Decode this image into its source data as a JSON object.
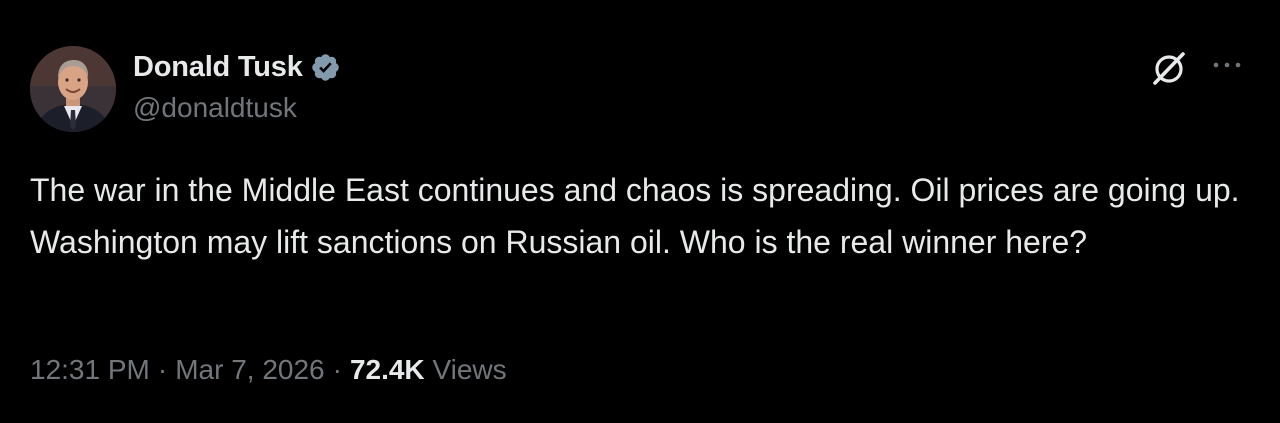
{
  "author": {
    "display_name": "Donald Tusk",
    "handle": "@donaldtusk",
    "verified": true
  },
  "post": {
    "text": "The war in the Middle East continues and chaos is spreading. Oil prices are going up. Washington may lift sanctions on Russian oil. Who is the real winner here?"
  },
  "meta": {
    "time": "12:31 PM",
    "separator": "·",
    "date": "Mar 7, 2026",
    "views_count": "72.4K",
    "views_label": "Views"
  },
  "icons": {
    "verified": "verified-badge-icon",
    "grok": "grok-icon",
    "more": "more-options-icon"
  },
  "colors": {
    "background": "#000000",
    "primary_text": "#e7e9ea",
    "secondary_text": "#71767b",
    "verified_badge": "#829aab"
  }
}
